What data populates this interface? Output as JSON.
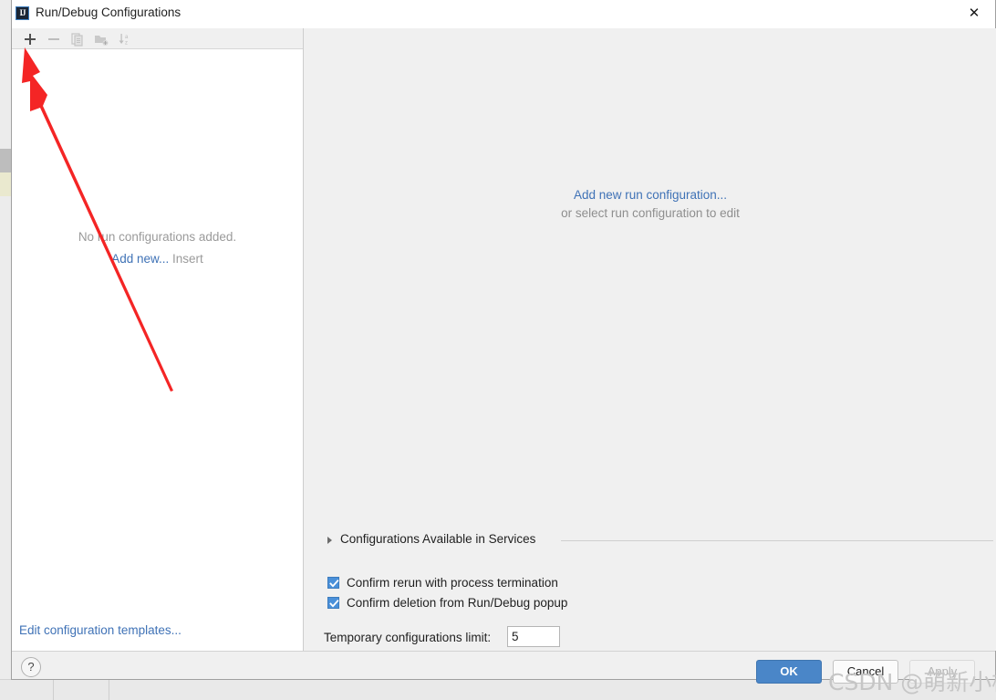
{
  "window": {
    "title": "Run/Debug Configurations",
    "app_icon": "intellij-idea-icon",
    "close_icon": "✕"
  },
  "toolbar": {
    "items": [
      {
        "name": "add-configuration-button",
        "icon": "plus-icon",
        "enabled": true
      },
      {
        "name": "remove-configuration-button",
        "icon": "minus-icon",
        "enabled": false
      },
      {
        "name": "copy-configuration-button",
        "icon": "copy-icon",
        "enabled": false
      },
      {
        "name": "new-folder-button",
        "icon": "new-folder-icon",
        "enabled": false
      },
      {
        "name": "sort-configurations-button",
        "icon": "sort-alpha-icon",
        "enabled": false
      }
    ]
  },
  "left_panel": {
    "empty_message": "No run configurations added.",
    "add_new_link": "Add new...",
    "add_new_shortcut": "Insert",
    "edit_templates_link": "Edit configuration templates..."
  },
  "right_panel": {
    "add_link": "Add new run configuration...",
    "hint": "or select run configuration to edit",
    "section": {
      "label": "Configurations Available in Services",
      "expanded": false,
      "chevron_icon": "triangle-right-icon"
    },
    "checkboxes": [
      {
        "label": "Confirm rerun with process termination",
        "checked": true
      },
      {
        "label": "Confirm deletion from Run/Debug popup",
        "checked": true
      }
    ],
    "temp_limit": {
      "label": "Temporary configurations limit:",
      "value": "5",
      "placeholder": ""
    }
  },
  "footer": {
    "help_label": "?",
    "ok_label": "OK",
    "cancel_label": "Cancel",
    "apply_label": "Apply",
    "apply_enabled": false
  },
  "annotation": {
    "arrow_color": "#f42525",
    "arrow_points_to": "add-configuration-button"
  },
  "watermark": {
    "text": "CSDN @萌新小杨"
  },
  "colors": {
    "accent_blue": "#4a86c8",
    "link_blue": "#3f72b6",
    "dialog_bg": "#f0f0f0",
    "panel_white": "#ffffff",
    "checkbox_blue": "#4a90d9",
    "annotation_red": "#f42525"
  }
}
